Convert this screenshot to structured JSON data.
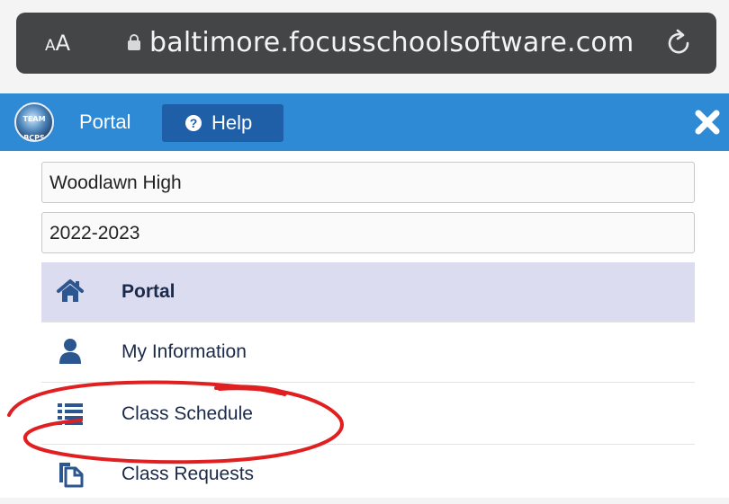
{
  "browser": {
    "text_size_control": {
      "small": "A",
      "large": "A"
    },
    "url": "baltimore.focusschoolsoftware.com",
    "icons": {
      "lock": "lock-icon",
      "reload": "reload-icon"
    }
  },
  "header": {
    "logo_text": [
      "TEAM",
      "BCPS"
    ],
    "portal_label": "Portal",
    "help_label": "Help",
    "help_icon_glyph": "?",
    "colors": {
      "bar": "#2f8ad6",
      "help_button": "#1f5fa8"
    }
  },
  "selectors": {
    "school": "Woodlawn High",
    "year": "2022-2023"
  },
  "menu": {
    "items": [
      {
        "label": "Portal",
        "icon": "home-icon",
        "active": true
      },
      {
        "label": "My Information",
        "icon": "user-icon",
        "active": false
      },
      {
        "label": "Class Schedule",
        "icon": "list-icon",
        "active": false
      },
      {
        "label": "Class Requests",
        "icon": "clipboard-icon",
        "active": false
      }
    ],
    "accent": "#dcdcf0",
    "icon_color": "#2b5690"
  },
  "annotation": {
    "color": "#e02020",
    "target": "Class Schedule"
  }
}
